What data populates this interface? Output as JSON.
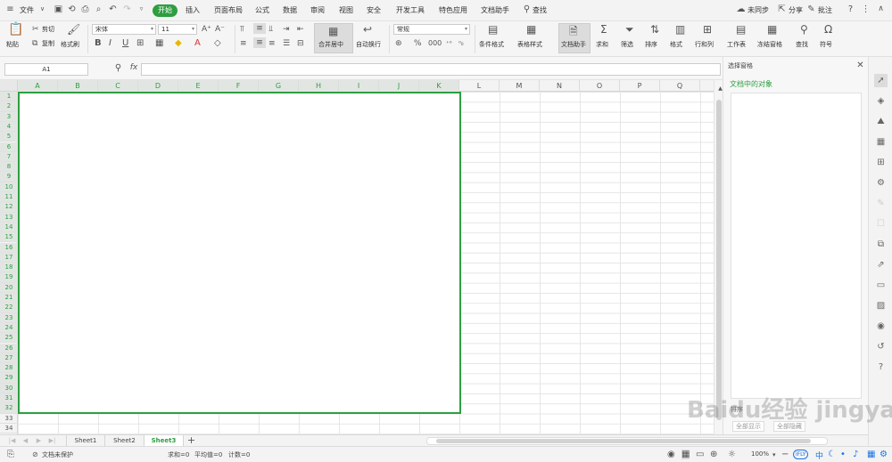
{
  "menu": {
    "file": "文件",
    "active_tab": "开始",
    "tabs": [
      "插入",
      "页面布局",
      "公式",
      "数据",
      "审阅",
      "视图",
      "安全",
      "开发工具",
      "特色应用",
      "文档助手"
    ],
    "search": "查找",
    "sync": "未同步",
    "share": "分享",
    "comment": "批注"
  },
  "ribbon": {
    "paste": "粘贴",
    "cut": "剪切",
    "copy": "复制",
    "format_painter": "格式刷",
    "font_name": "宋体",
    "font_size": "11",
    "merge_center": "合并居中",
    "wrap_text": "自动换行",
    "number_format": "常规",
    "conditional_format": "条件格式",
    "table_style": "表格样式",
    "doc_assistant": "文档助手",
    "sum": "求和",
    "filter": "筛选",
    "sort": "排序",
    "format": "格式",
    "row_col": "行和列",
    "worksheet": "工作表",
    "freeze": "冻结窗格",
    "find": "查找",
    "symbol": "符号"
  },
  "formula_bar": {
    "name_box": "A1",
    "fx": "fx"
  },
  "columns": [
    "A",
    "B",
    "C",
    "D",
    "E",
    "F",
    "G",
    "H",
    "I",
    "J",
    "K",
    "L",
    "M",
    "N",
    "O",
    "P",
    "Q"
  ],
  "rows": [
    "1",
    "2",
    "3",
    "4",
    "5",
    "6",
    "7",
    "8",
    "9",
    "10",
    "11",
    "12",
    "13",
    "14",
    "15",
    "16",
    "17",
    "18",
    "19",
    "20",
    "21",
    "22",
    "23",
    "24",
    "25",
    "26",
    "27",
    "28",
    "29",
    "30",
    "31",
    "32",
    "33",
    "34"
  ],
  "pane": {
    "title": "选择窗格",
    "subtitle": "文档中的对象",
    "show_all": "全部显示",
    "hide_all": "全部隐藏",
    "prefix": "排序"
  },
  "sheets": [
    "Sheet1",
    "Sheet2",
    "Sheet3"
  ],
  "status": {
    "protect": "文档未保护",
    "sum": "求和=0",
    "avg": "平均值=0",
    "count": "计数=0",
    "zoom": "100%",
    "ime": "中"
  },
  "colors": {
    "accent": "#2e9e41"
  },
  "watermark": "Baidu经验 jingyan.baidu.com"
}
